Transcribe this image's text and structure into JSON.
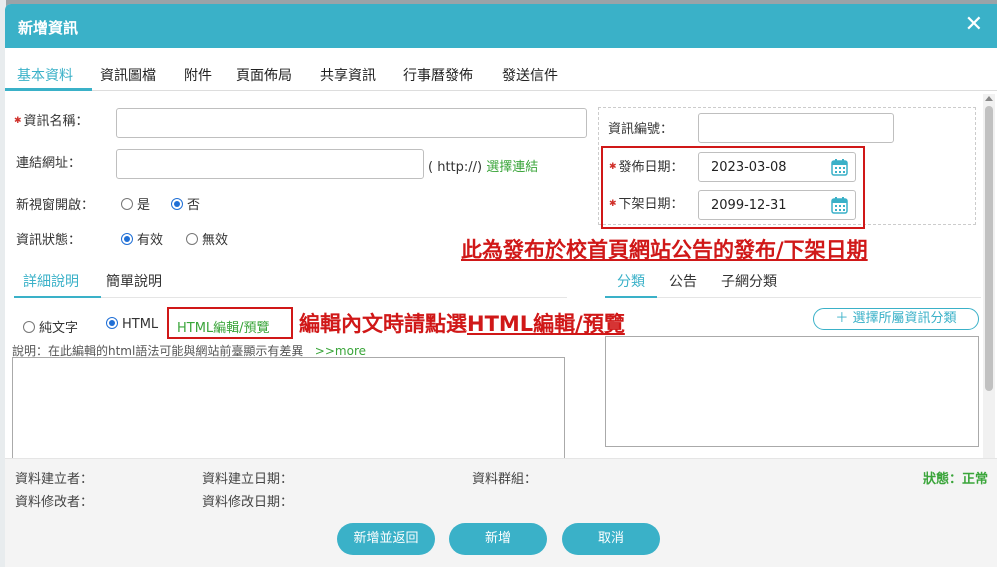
{
  "dialog": {
    "title": "新增資訊",
    "close": "✕"
  },
  "tabs": [
    "基本資料",
    "資訊圖檔",
    "附件",
    "頁面佈局",
    "共享資訊",
    "行事曆發佈",
    "發送信件"
  ],
  "form": {
    "name_label": "資訊名稱：",
    "url_label": "連結網址：",
    "url_hint": "( http://)",
    "url_select": "選擇連結",
    "newwin_label": "新視窗開啟：",
    "newwin_yes": "是",
    "newwin_no": "否",
    "status_label": "資訊狀態：",
    "status_valid": "有效",
    "status_invalid": "無效",
    "id_label": "資訊編號：",
    "publish_label": "發佈日期：",
    "publish_value": "2023-03-08",
    "offline_label": "下架日期：",
    "offline_value": "2099-12-31"
  },
  "annotations": {
    "dates_note": "此為發布於校首頁網站公告的發布/下架日期",
    "html_note_prefix": "編輯內文時請點選",
    "html_note_link": "HTML編輯/預覽"
  },
  "desc": {
    "tab_detail": "詳細說明",
    "tab_brief": "簡單說明",
    "plain_text": "純文字",
    "html": "HTML",
    "html_edit": "HTML編輯/預覽",
    "note": "說明：在此編輯的html語法可能與網站前臺顯示有差異",
    "more": ">>more"
  },
  "category": {
    "tab_category": "分類",
    "tab_notice": "公告",
    "tab_subnet": "子網分類",
    "select_button": "＋ 選擇所屬資訊分類"
  },
  "footer": {
    "creator": "資料建立者：",
    "created_date": "資料建立日期：",
    "group": "資料群組：",
    "modifier": "資料修改者：",
    "modified_date": "資料修改日期：",
    "status": "狀態：正常"
  },
  "buttons": {
    "add_return": "新增並返回",
    "add": "新增",
    "cancel": "取消"
  },
  "colors": {
    "accent": "#3ab1c8",
    "annotation": "#d01818",
    "link": "#3aa53a"
  }
}
